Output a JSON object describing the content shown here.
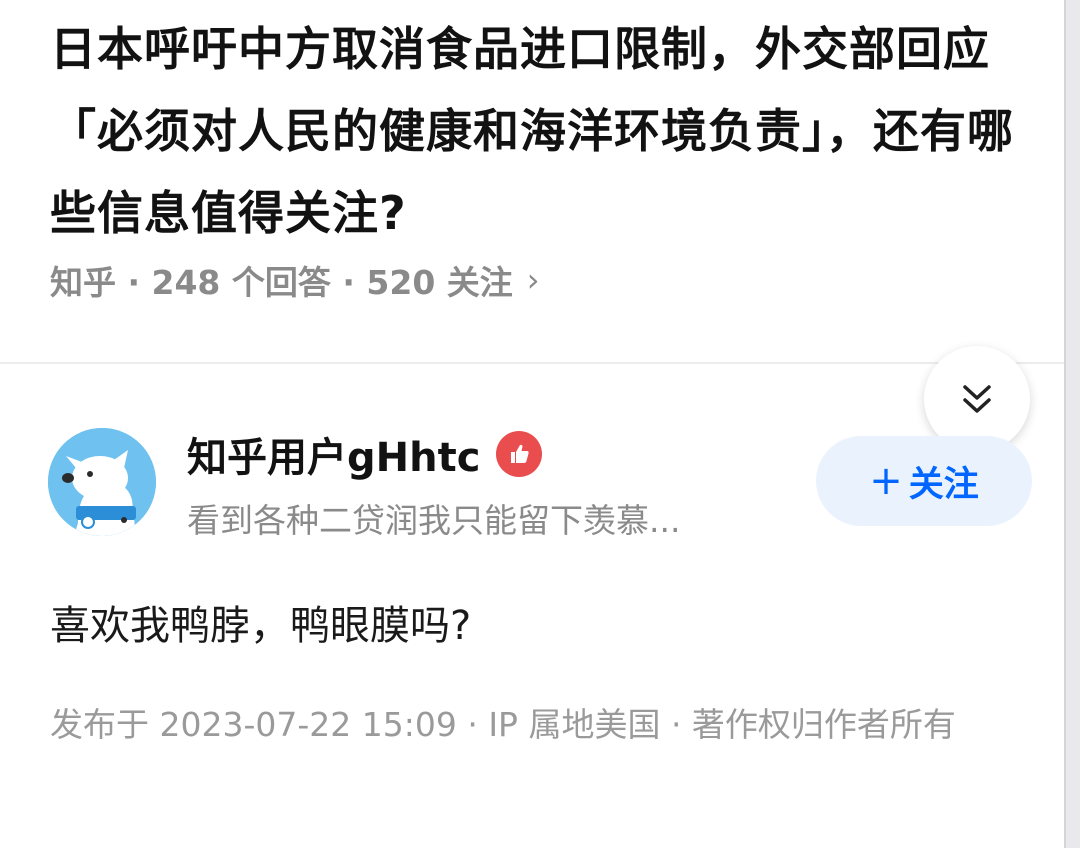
{
  "question": {
    "title": "日本呼吁中方取消食品进口限制，外交部回应「必须对人民的健康和海洋环境负责」，还有哪些信息值得关注?",
    "meta": "知乎 · 248 个回答 · 520 关注",
    "meta_chevron": "›"
  },
  "collapse_icon": "double-chevron-down-icon",
  "author": {
    "name": "知乎用户gHhtc",
    "bio": "看到各种二贷润我只能留下羡慕...",
    "avatar_icon": "dog-avatar",
    "badge_icon": "thumbs-up-icon"
  },
  "follow_button": {
    "plus": "+",
    "label": "关注"
  },
  "answer": {
    "content": "喜欢我鸭脖，鸭眼膜吗?",
    "meta": "发布于 2023-07-22 15:09 · IP 属地美国 · 著作权归作者所有"
  },
  "colors": {
    "accent": "#0066ff",
    "follow_bg": "#eaf3fd",
    "badge": "#e94d4d",
    "meta_text": "#8a8a8a"
  }
}
